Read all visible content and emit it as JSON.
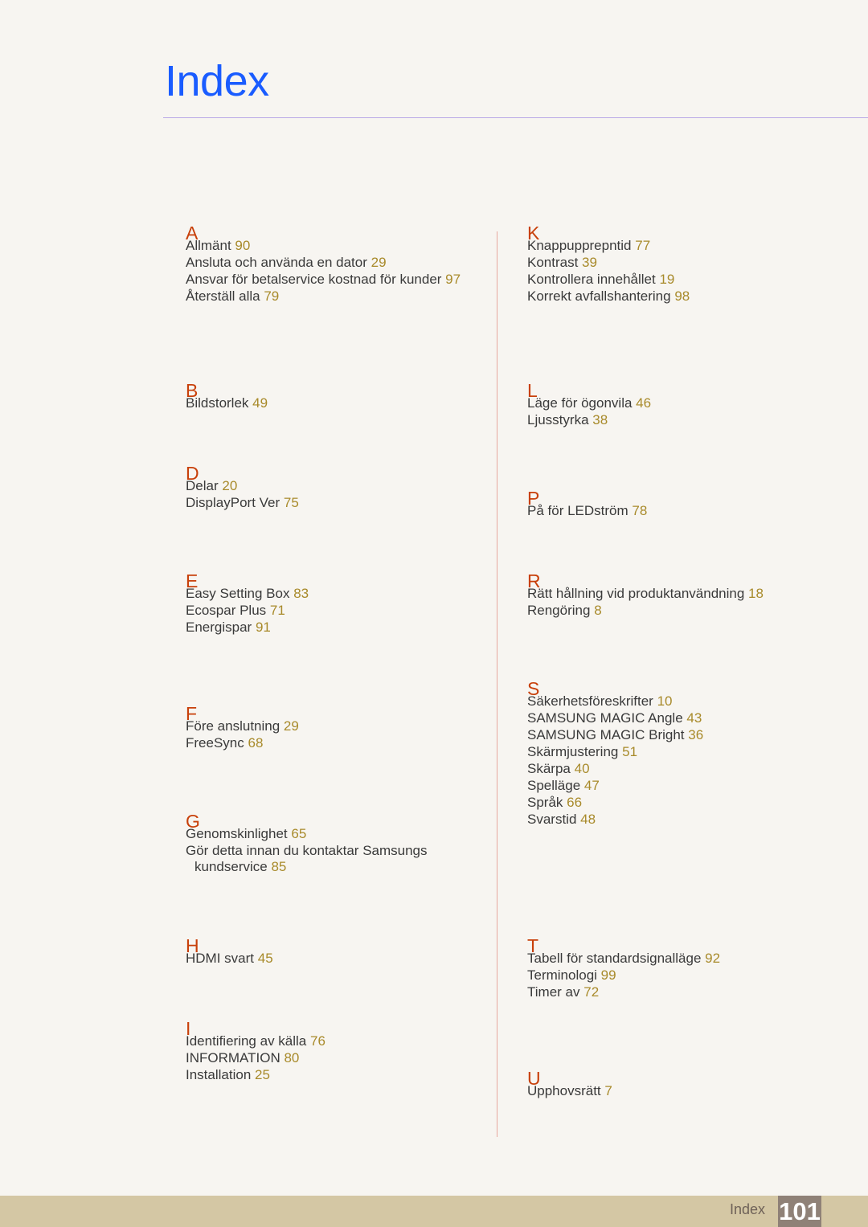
{
  "title": "Index",
  "left_sections": [
    {
      "letter": "A",
      "items": [
        {
          "t": "Allmänt",
          "p": "90"
        },
        {
          "t": "Ansluta och använda en dator",
          "p": "29"
        },
        {
          "t": "Ansvar för betalservice kostnad för kunder",
          "p": "97"
        },
        {
          "t": "Återställ alla",
          "p": "79"
        }
      ]
    },
    {
      "letter": "B",
      "items": [
        {
          "t": "Bildstorlek",
          "p": "49"
        }
      ]
    },
    {
      "letter": "D",
      "items": [
        {
          "t": "Delar",
          "p": "20"
        },
        {
          "t": "DisplayPort Ver",
          "p": "75"
        }
      ]
    },
    {
      "letter": "E",
      "items": [
        {
          "t": "Easy Setting Box",
          "p": "83"
        },
        {
          "t": "Ecospar Plus",
          "p": "71"
        },
        {
          "t": "Energispar",
          "p": "91"
        }
      ]
    },
    {
      "letter": "F",
      "items": [
        {
          "t": "Före anslutning",
          "p": "29"
        },
        {
          "t": "FreeSync",
          "p": "68"
        }
      ]
    },
    {
      "letter": "G",
      "items": [
        {
          "t": "Genomskinlighet",
          "p": "65"
        },
        {
          "t": "Gör detta innan du kontaktar Samsungs kundservice",
          "p": "85"
        }
      ]
    },
    {
      "letter": "H",
      "items": [
        {
          "t": "HDMI svart",
          "p": "45"
        }
      ]
    },
    {
      "letter": "I",
      "items": [
        {
          "t": "Identifiering av källa",
          "p": "76"
        },
        {
          "t": "INFORMATION",
          "p": "80"
        },
        {
          "t": "Installation",
          "p": "25"
        }
      ]
    }
  ],
  "right_sections": [
    {
      "letter": "K",
      "items": [
        {
          "t": "Knappupprepntid",
          "p": "77"
        },
        {
          "t": "Kontrast",
          "p": "39"
        },
        {
          "t": "Kontrollera innehållet",
          "p": "19"
        },
        {
          "t": "Korrekt avfallshantering",
          "p": "98"
        }
      ]
    },
    {
      "letter": "L",
      "items": [
        {
          "t": "Läge för ögonvila",
          "p": "46"
        },
        {
          "t": "Ljusstyrka",
          "p": "38"
        }
      ]
    },
    {
      "letter": "P",
      "items": [
        {
          "t": "På för LEDström",
          "p": "78"
        }
      ]
    },
    {
      "letter": "R",
      "items": [
        {
          "t": "Rätt hållning vid produktanvändning",
          "p": "18"
        },
        {
          "t": "Rengöring",
          "p": "8"
        }
      ]
    },
    {
      "letter": "S",
      "items": [
        {
          "t": "Säkerhetsföreskrifter",
          "p": "10"
        },
        {
          "t": "SAMSUNG MAGIC Angle",
          "p": "43"
        },
        {
          "t": "SAMSUNG MAGIC Bright",
          "p": "36"
        },
        {
          "t": "Skärmjustering",
          "p": "51"
        },
        {
          "t": "Skärpa",
          "p": "40"
        },
        {
          "t": "Spelläge",
          "p": "47"
        },
        {
          "t": "Språk",
          "p": "66"
        },
        {
          "t": "Svarstid",
          "p": "48"
        }
      ]
    },
    {
      "letter": "T",
      "items": [
        {
          "t": "Tabell för standardsignalläge",
          "p": "92"
        },
        {
          "t": "Terminologi",
          "p": "99"
        },
        {
          "t": "Timer av",
          "p": "72"
        }
      ]
    },
    {
      "letter": "U",
      "items": [
        {
          "t": "Upphovsrätt",
          "p": "7"
        }
      ]
    }
  ],
  "footer": {
    "label": "Index",
    "page": "101"
  }
}
